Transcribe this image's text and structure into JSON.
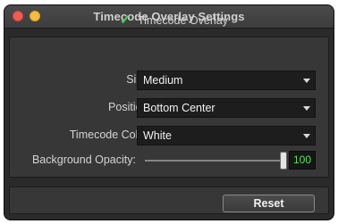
{
  "window": {
    "title": "Timecode Overlay Settings"
  },
  "overlay_toggle": {
    "label": "Timecode Overlay",
    "checked": true
  },
  "size": {
    "label": "Size:",
    "value": "Medium"
  },
  "position": {
    "label": "Position:",
    "value": "Bottom Center"
  },
  "timecode_color": {
    "label": "Timecode Color:",
    "value": "White"
  },
  "background_opacity": {
    "label": "Background Opacity:",
    "value": "100",
    "max": 100,
    "min": 0
  },
  "reset_label": "Reset",
  "colors": {
    "checkmark": "#4fc95a",
    "opacity_readout": "#5ee05e"
  },
  "icons": {
    "close": "close-icon",
    "minimize": "minimize-icon",
    "check": "checkmark-icon",
    "caret": "chevron-down-icon"
  }
}
